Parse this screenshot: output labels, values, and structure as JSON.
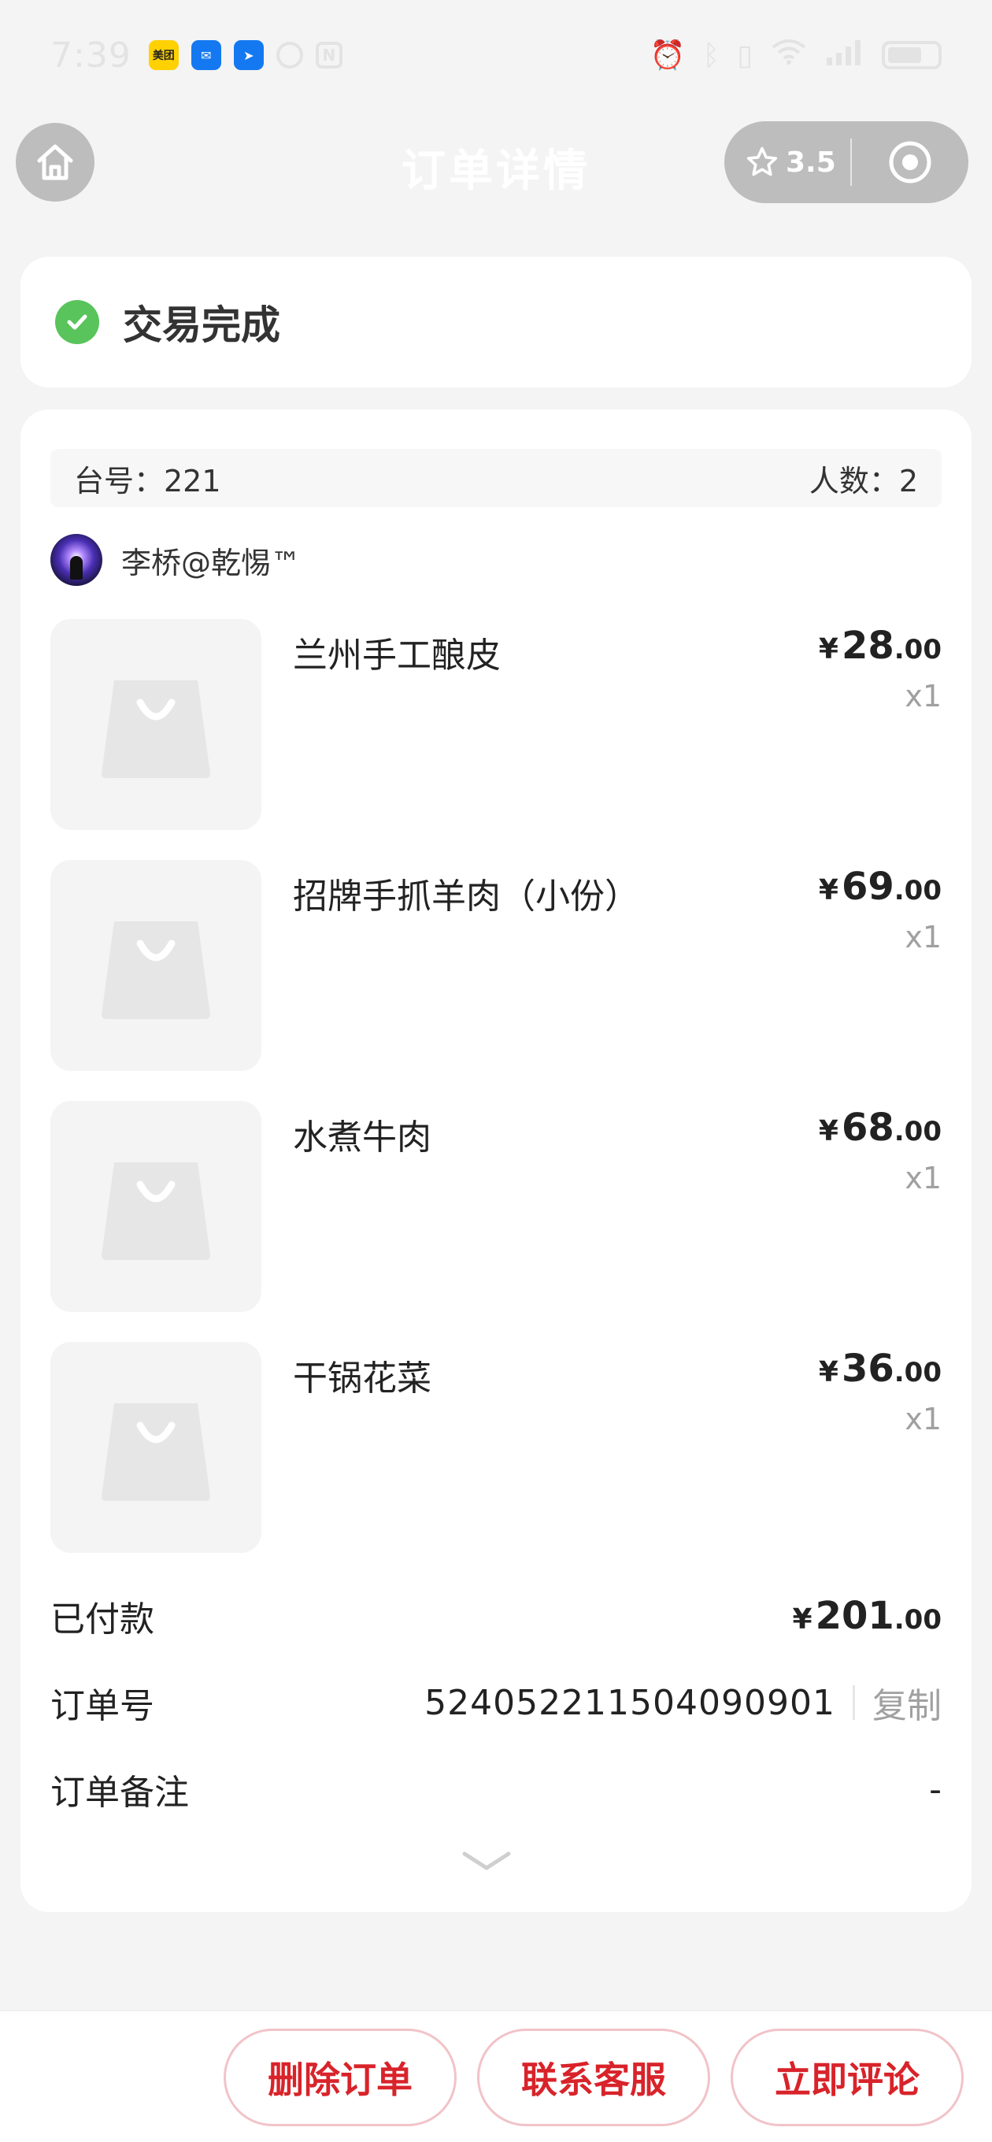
{
  "status_bar": {
    "time": "7:39",
    "apps": [
      "美团",
      "mail-icon",
      "navigation-icon",
      "ghost-icon",
      "nfc-icon"
    ]
  },
  "nav": {
    "title": "订单详情",
    "rating": "3.5"
  },
  "order_status": {
    "text": "交易完成",
    "color": "#58c45b"
  },
  "table_info": {
    "table_label": "台号：221",
    "people_label": "人数：2"
  },
  "user": {
    "name": "李桥@乾惕™"
  },
  "items": [
    {
      "name": "兰州手工酿皮",
      "yen": "¥",
      "price_int": "28",
      "price_dec": ".00",
      "qty": "x1"
    },
    {
      "name": "招牌手抓羊肉（小份）",
      "yen": "¥",
      "price_int": "69",
      "price_dec": ".00",
      "qty": "x1"
    },
    {
      "name": "水煮牛肉",
      "yen": "¥",
      "price_int": "68",
      "price_dec": ".00",
      "qty": "x1"
    },
    {
      "name": "干锅花菜",
      "yen": "¥",
      "price_int": "36",
      "price_dec": ".00",
      "qty": "x1"
    }
  ],
  "summary": {
    "paid_label": "已付款",
    "paid_yen": "¥",
    "paid_int": "201",
    "paid_dec": ".00",
    "order_no_label": "订单号",
    "order_no": "524052211504090901",
    "copy_label": "复制",
    "remark_label": "订单备注",
    "remark_value": "-"
  },
  "actions": {
    "delete": "删除订单",
    "contact": "联系客服",
    "review": "立即评论"
  },
  "colors": {
    "accent_red": "#d8232a",
    "success_green": "#58c45b"
  }
}
